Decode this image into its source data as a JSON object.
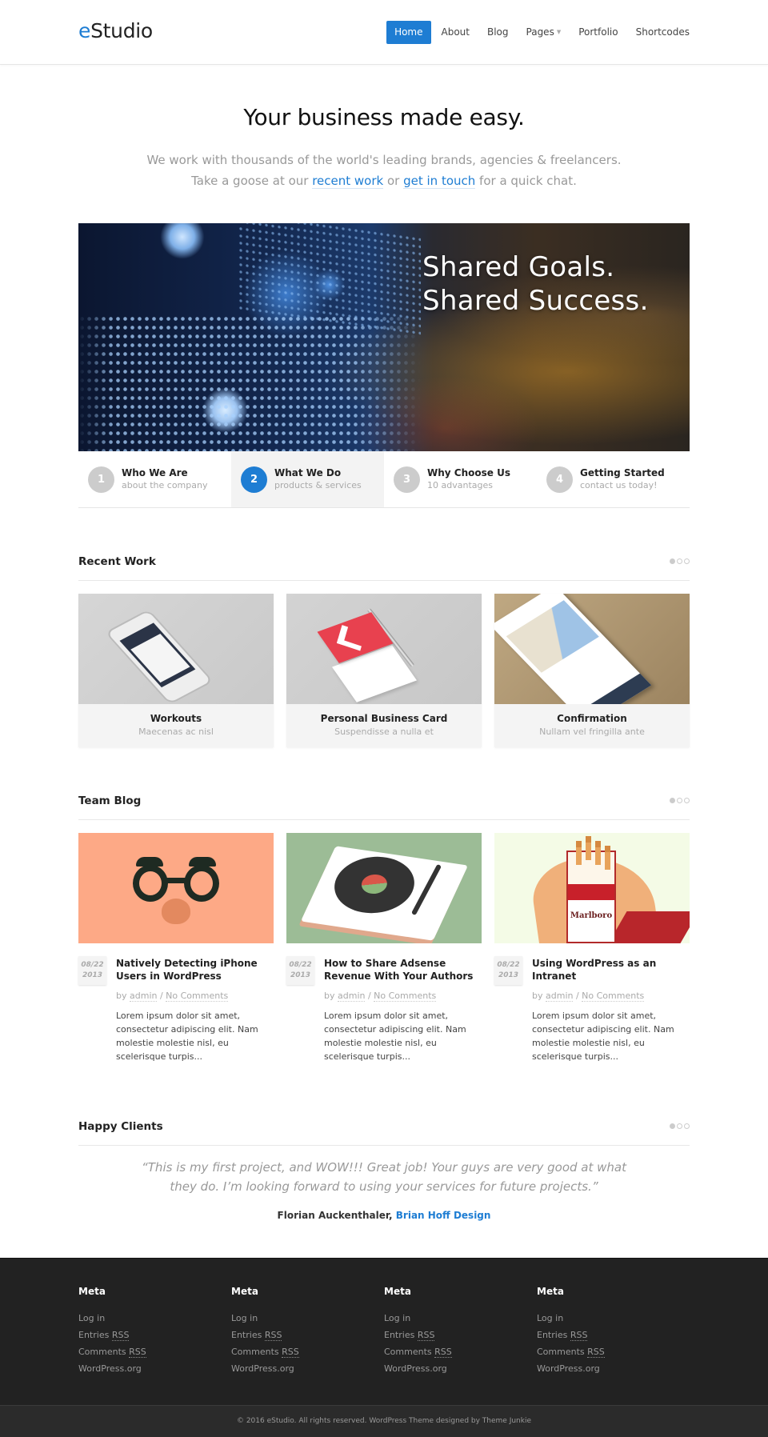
{
  "header": {
    "logo_accent": "e",
    "logo_rest": "Studio",
    "nav": [
      {
        "label": "Home",
        "active": true
      },
      {
        "label": "About"
      },
      {
        "label": "Blog"
      },
      {
        "label": "Pages",
        "dropdown": true
      },
      {
        "label": "Portfolio"
      },
      {
        "label": "Shortcodes"
      }
    ],
    "dropdown_glyph": "▼"
  },
  "intro": {
    "title": "Your business made easy.",
    "line1": "We work with thousands of the world's leading brands, agencies & freelancers.",
    "line2_pre": "Take a goose at our ",
    "link1": "recent work",
    "line2_mid": " or ",
    "link2": "get in touch",
    "line2_post": " for a quick chat."
  },
  "slider": {
    "caption_line1": "Shared Goals.",
    "caption_line2": "Shared Success."
  },
  "tabs": [
    {
      "num": "1",
      "title": "Who We Are",
      "sub": "about the company"
    },
    {
      "num": "2",
      "title": "What We Do",
      "sub": "products & services",
      "active": true
    },
    {
      "num": "3",
      "title": "Why Choose Us",
      "sub": "10 advantages"
    },
    {
      "num": "4",
      "title": "Getting Started",
      "sub": "contact us today!"
    }
  ],
  "recent_work": {
    "heading": "Recent Work",
    "items": [
      {
        "title": "Workouts",
        "sub": "Maecenas ac nisl"
      },
      {
        "title": "Personal Business Card",
        "sub": "Suspendisse a nulla et"
      },
      {
        "title": "Confirmation",
        "sub": "Nullam vel fringilla ante"
      }
    ]
  },
  "team_blog": {
    "heading": "Team Blog",
    "posts": [
      {
        "date_md": "08/22",
        "date_y": "2013",
        "title": "Natively Detecting iPhone Users in WordPress",
        "by": "by ",
        "author": "admin",
        "sep": " / ",
        "comments": "No Comments",
        "excerpt": "Lorem ipsum dolor sit amet, consectetur adipiscing elit. Nam molestie molestie nisl, eu scelerisque turpis..."
      },
      {
        "date_md": "08/22",
        "date_y": "2013",
        "title": "How to Share Adsense Revenue With Your Authors",
        "by": "by ",
        "author": "admin",
        "sep": " / ",
        "comments": "No Comments",
        "excerpt": "Lorem ipsum dolor sit amet, consectetur adipiscing elit. Nam molestie molestie nisl, eu scelerisque turpis..."
      },
      {
        "date_md": "08/22",
        "date_y": "2013",
        "title": "Using WordPress as an Intranet",
        "by": "by ",
        "author": "admin",
        "sep": " / ",
        "comments": "No Comments",
        "excerpt": "Lorem ipsum dolor sit amet, consectetur adipiscing elit. Nam molestie molestie nisl, eu scelerisque turpis..."
      }
    ],
    "image_3_brand": "Marlboro"
  },
  "happy_clients": {
    "heading": "Happy Clients",
    "quote": "“This is my first project, and WOW!!! Great job! Your guys are very good at what they do. I’m looking forward to using your services for future projects.”",
    "author": "Florian Auckenthaler, ",
    "company": "Brian Hoff Design"
  },
  "footer": {
    "columns": [
      {
        "heading": "Meta",
        "links": [
          "Log in",
          "Entries",
          "Comments",
          "WordPress.org"
        ]
      },
      {
        "heading": "Meta",
        "links": [
          "Log in",
          "Entries",
          "Comments",
          "WordPress.org"
        ]
      },
      {
        "heading": "Meta",
        "links": [
          "Log in",
          "Entries",
          "Comments",
          "WordPress.org"
        ]
      },
      {
        "heading": "Meta",
        "links": [
          "Log in",
          "Entries",
          "Comments",
          "WordPress.org"
        ]
      }
    ],
    "rss": "RSS",
    "copyright": "© 2016 eStudio. All rights reserved. WordPress Theme designed by Theme Junkie"
  },
  "colors": {
    "accent": "#1e7dd3",
    "footer_bg": "#222222",
    "bottom_bg": "#2b2b2b"
  }
}
